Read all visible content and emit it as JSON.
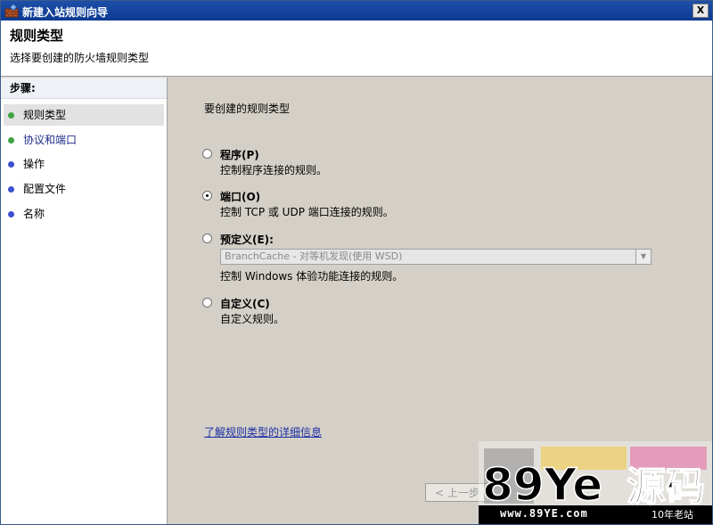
{
  "window": {
    "title": "新建入站规则向导",
    "close_symbol": "X"
  },
  "header": {
    "title": "规则类型",
    "subtitle": "选择要创建的防火墙规则类型"
  },
  "sidebar": {
    "steps_title": "步骤:",
    "items": [
      {
        "label": "规则类型",
        "dot_color": "#3fa33f",
        "active": true
      },
      {
        "label": "协议和端口",
        "dot_color": "#3fa33f",
        "active": false
      },
      {
        "label": "操作",
        "dot_color": "#3b4fd0",
        "active": false
      },
      {
        "label": "配置文件",
        "dot_color": "#3b4fd0",
        "active": false
      },
      {
        "label": "名称",
        "dot_color": "#3b4fd0",
        "active": false
      }
    ]
  },
  "main": {
    "prompt": "要创建的规则类型",
    "options": [
      {
        "label": "程序(P)",
        "description": "控制程序连接的规则。",
        "checked": false
      },
      {
        "label": "端口(O)",
        "description": "控制 TCP 或 UDP 端口连接的规则。",
        "checked": true
      },
      {
        "label": "预定义(E):",
        "description": "控制 Windows 体验功能连接的规则。",
        "checked": false
      },
      {
        "label": "自定义(C)",
        "description": "自定义规则。",
        "checked": false
      }
    ],
    "predefined_select_value": "BranchCache - 对等机发现(使用 WSD)",
    "learn_more_link": "了解规则类型的详细信息",
    "back_button": "< 上一步"
  },
  "watermark": {
    "brand": "89Ye源码",
    "domain": "www.89YE.com",
    "tag": "10年老站"
  }
}
